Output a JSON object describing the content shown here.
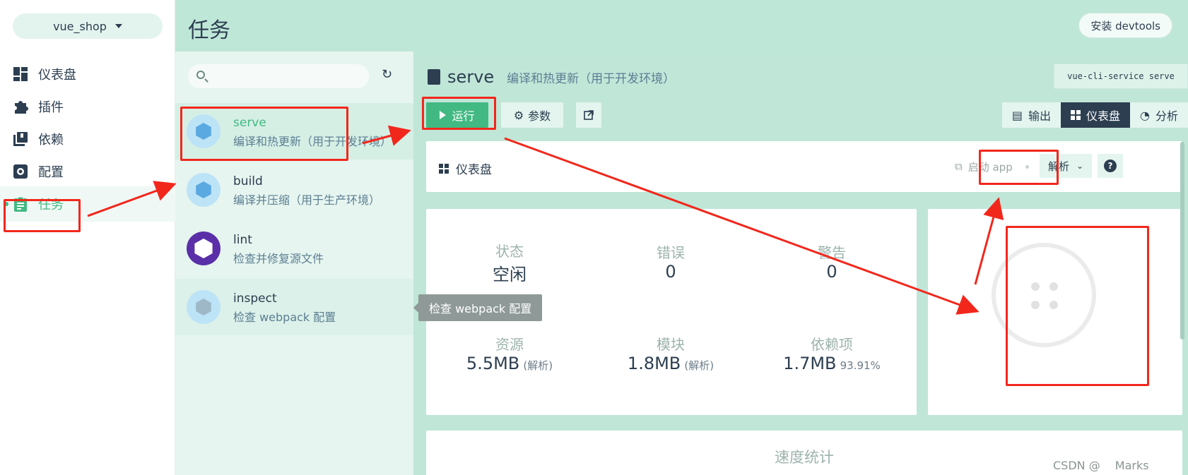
{
  "nav": {
    "project": "vue_shop",
    "items": [
      {
        "label": "仪表盘",
        "icon": "dashboard-icon"
      },
      {
        "label": "插件",
        "icon": "puzzle-icon"
      },
      {
        "label": "依赖",
        "icon": "library-icon"
      },
      {
        "label": "配置",
        "icon": "settings-icon"
      },
      {
        "label": "任务",
        "icon": "clipboard-icon",
        "active": true
      }
    ]
  },
  "topbar": {
    "title": "任务",
    "devtools_button": "安装 devtools"
  },
  "tasks": {
    "search_placeholder": "",
    "items": [
      {
        "name": "serve",
        "desc": "编译和热更新（用于开发环境）",
        "selected": true
      },
      {
        "name": "build",
        "desc": "编译并压缩（用于生产环境）"
      },
      {
        "name": "lint",
        "desc": "检查并修复源文件"
      },
      {
        "name": "inspect",
        "desc": "检查 webpack 配置"
      }
    ],
    "tooltip": "检查 webpack 配置"
  },
  "main": {
    "task_name": "serve",
    "task_desc": "编译和热更新（用于开发环境）",
    "command": "vue-cli-service serve",
    "run_label": "运行",
    "params_label": "参数",
    "view_tabs": [
      "输出",
      "仪表盘",
      "分析"
    ],
    "active_view_tab": "仪表盘",
    "dashboard": {
      "title": "仪表盘",
      "start_app": "启动 app",
      "analyze": "解析",
      "help": "?"
    },
    "stats": {
      "status": {
        "label": "状态",
        "value": "空闲"
      },
      "errors": {
        "label": "错误",
        "value": "0"
      },
      "warnings": {
        "label": "警告",
        "value": "0"
      },
      "assets": {
        "label": "资源",
        "value": "5.5MB",
        "sub": "(解析)"
      },
      "modules": {
        "label": "模块",
        "value": "1.8MB",
        "sub": "(解析)"
      },
      "deps": {
        "label": "依赖项",
        "value": "1.7MB",
        "sub": "93.91%"
      }
    },
    "speed_title": "速度统计"
  },
  "watermark": "CSDN @　 Marks",
  "colors": {
    "accent": "#42b983",
    "dark": "#2c3e50",
    "topbar": "#bfe7d8",
    "annotation": "#f2271c"
  }
}
